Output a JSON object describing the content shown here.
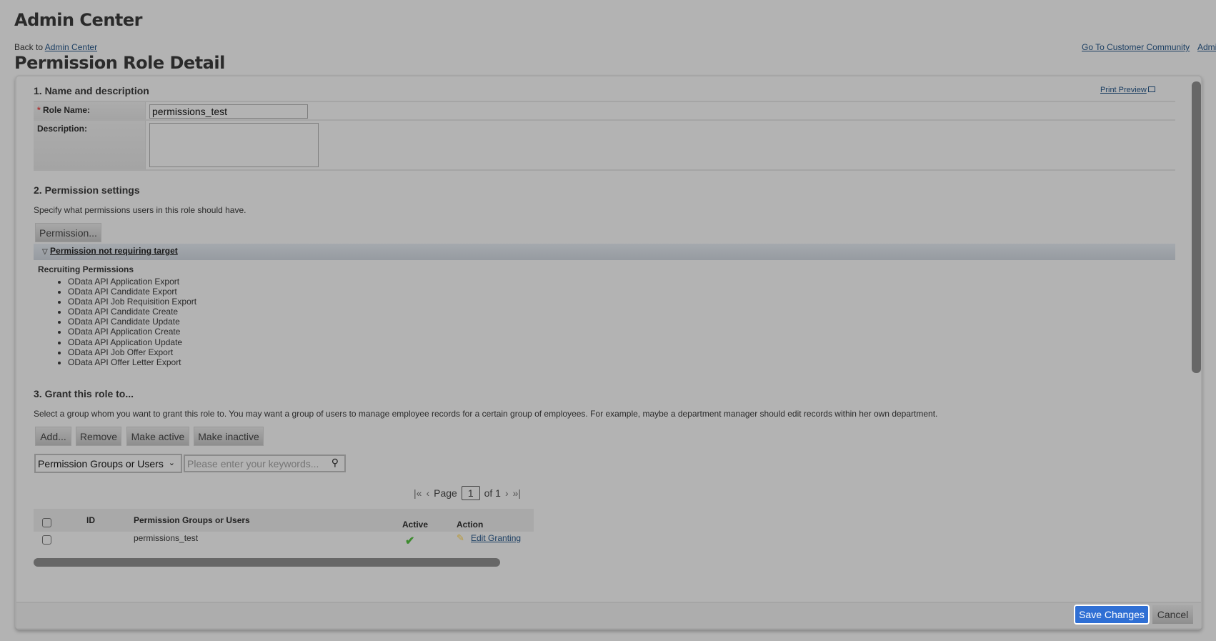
{
  "header": {
    "app_title": "Admin Center",
    "back_prefix": "Back to",
    "back_link": "Admin Center",
    "page_title": "Permission Role Detail",
    "top_links": [
      "Go To Customer Community",
      "Admi"
    ]
  },
  "section1": {
    "title": "1. Name and description",
    "print_preview": "Print Preview",
    "role_name_label": "Role Name:",
    "role_name_value": "permissions_test",
    "description_label": "Description:",
    "description_value": ""
  },
  "section2": {
    "title": "2. Permission settings",
    "description": "Specify what permissions users in this role should have.",
    "permission_button": "Permission...",
    "group_header": "Permission not requiring target",
    "category": "Recruiting Permissions",
    "items": [
      "OData API Application Export",
      "OData API Candidate Export",
      "OData API Job Requisition Export",
      "OData API Candidate Create",
      "OData API Candidate Update",
      "OData API Application Create",
      "OData API Application Update",
      "OData API Job Offer Export",
      "OData API Offer Letter Export"
    ]
  },
  "section3": {
    "title": "3. Grant this role to...",
    "description": "Select a group whom you want to grant this role to. You may want a group of users to manage employee records for a certain group of employees. For example, maybe a department manager should edit records within her own department.",
    "buttons": [
      "Add...",
      "Remove",
      "Make active",
      "Make inactive"
    ],
    "filter_select": "Permission Groups or Users",
    "search_placeholder": "Please enter your keywords...",
    "pager": {
      "label": "Page",
      "current": "1",
      "of": "of 1"
    },
    "table": {
      "columns": [
        "ID",
        "Permission Groups or Users",
        "Active",
        "Action"
      ],
      "rows": [
        {
          "id": "",
          "name": "permissions_test",
          "active": true,
          "action": "Edit Granting"
        }
      ]
    }
  },
  "footer": {
    "save": "Save Changes",
    "cancel": "Cancel"
  },
  "colors": {
    "primary_button": "#2f6fd4",
    "link": "#1c3f63",
    "check": "#3d8b2f"
  }
}
